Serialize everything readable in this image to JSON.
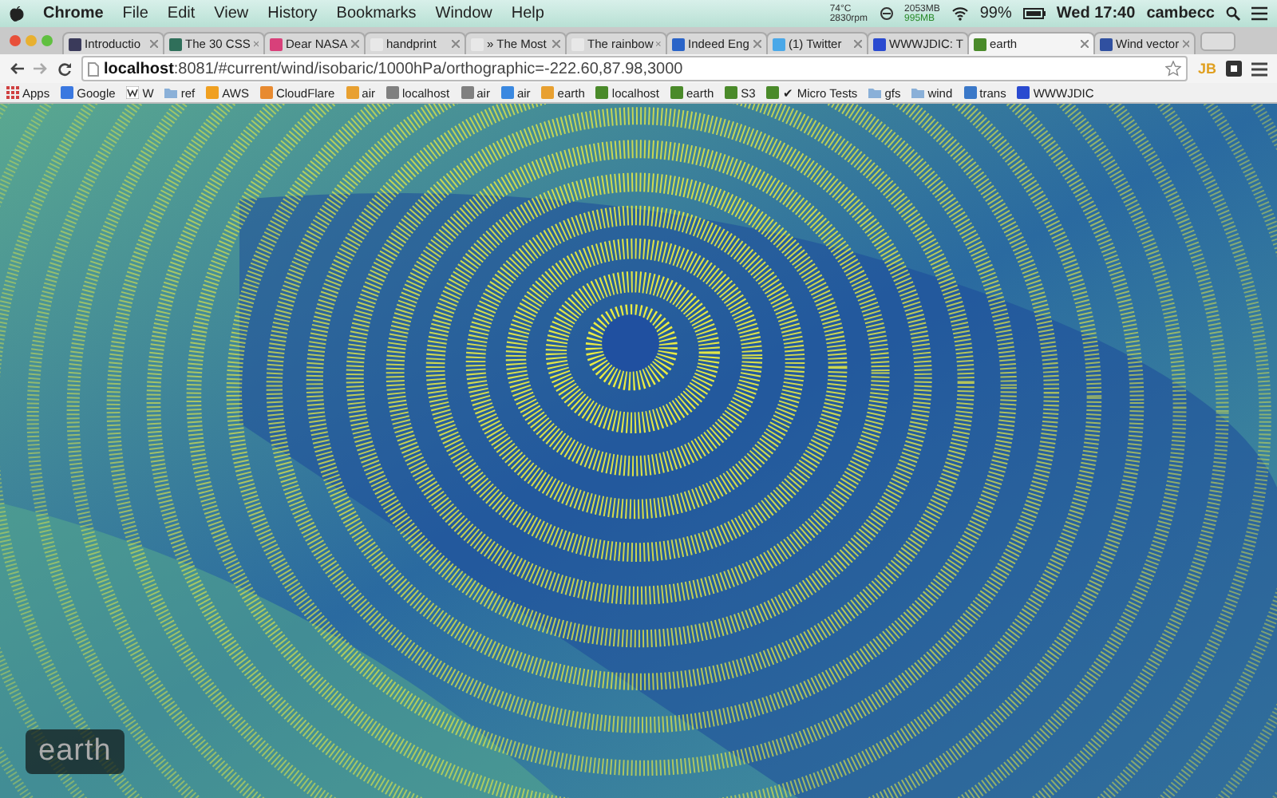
{
  "menu_bar": {
    "app": "Chrome",
    "menus": [
      "File",
      "Edit",
      "View",
      "History",
      "Bookmarks",
      "Window",
      "Help"
    ],
    "status": {
      "temperature": "74°C",
      "fan": "2830rpm",
      "memory_used": "2053MB",
      "memory_free": "995MB",
      "battery": "99%",
      "clock": "Wed 17:40",
      "user": "cambecc"
    }
  },
  "tabs": [
    {
      "title": "Introductio",
      "selected": false,
      "color": "#3a3a5a"
    },
    {
      "title": "The 30 CSS",
      "selected": false,
      "color": "#2f6f5a"
    },
    {
      "title": "Dear NASA",
      "selected": false,
      "color": "#d8407a"
    },
    {
      "title": "handprint",
      "selected": false,
      "color": "#e8e8e8"
    },
    {
      "title": "» The Most",
      "selected": false,
      "color": "#e8e8e8"
    },
    {
      "title": "The rainbow",
      "selected": false,
      "color": "#e8e8e8"
    },
    {
      "title": "Indeed Eng",
      "selected": false,
      "color": "#2a64c8"
    },
    {
      "title": "(1) Twitter",
      "selected": false,
      "color": "#4aa8e8"
    },
    {
      "title": "WWWJDIC: T",
      "selected": false,
      "color": "#2a4ad0"
    },
    {
      "title": "earth",
      "selected": true,
      "color": "#4a8a2a"
    },
    {
      "title": "Wind vector",
      "selected": false,
      "color": "#3050a0"
    }
  ],
  "address_bar": {
    "url": "**localhost**:8081/#current/wind/isobaric/1000hPa/orthographic=-222.60,87.98,3000",
    "extension": "JB"
  },
  "bookmarks": [
    {
      "label": "Apps",
      "kind": "apps",
      "color": "#d04040"
    },
    {
      "label": "Google",
      "kind": "site",
      "color": "#3a78e0"
    },
    {
      "label": "W",
      "kind": "wiki",
      "color": "#ffffff"
    },
    {
      "label": "ref",
      "kind": "folder",
      "color": "#8ab0d8"
    },
    {
      "label": "AWS",
      "kind": "site",
      "color": "#f0a020"
    },
    {
      "label": "CloudFlare",
      "kind": "site",
      "color": "#e88a30"
    },
    {
      "label": "air",
      "kind": "site",
      "color": "#e8a030"
    },
    {
      "label": "localhost",
      "kind": "site",
      "color": "#808080"
    },
    {
      "label": "air",
      "kind": "site",
      "color": "#808080"
    },
    {
      "label": "air",
      "kind": "site",
      "color": "#3a88e0"
    },
    {
      "label": "earth",
      "kind": "site",
      "color": "#e8a030"
    },
    {
      "label": "localhost",
      "kind": "site",
      "color": "#4a8a2a"
    },
    {
      "label": "earth",
      "kind": "site",
      "color": "#4a8a2a"
    },
    {
      "label": "S3",
      "kind": "site",
      "color": "#4a8a2a"
    },
    {
      "label": "✔ Micro Tests",
      "kind": "site",
      "color": "#4a8a2a"
    },
    {
      "label": "gfs",
      "kind": "folder",
      "color": "#8ab0d8"
    },
    {
      "label": "wind",
      "kind": "folder",
      "color": "#8ab0d8"
    },
    {
      "label": "trans",
      "kind": "site",
      "color": "#3a78c8"
    },
    {
      "label": "WWWJDIC",
      "kind": "site",
      "color": "#2a4ad0"
    }
  ],
  "map": {
    "badge": "earth"
  }
}
